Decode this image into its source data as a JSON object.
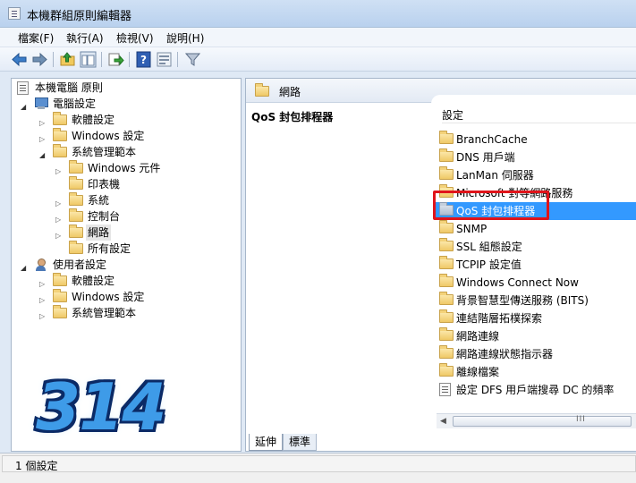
{
  "window": {
    "title": "本機群組原則編輯器"
  },
  "menu": [
    "檔案(F)",
    "執行(A)",
    "檢視(V)",
    "說明(H)"
  ],
  "toolbar": {
    "buttons": [
      "back-icon",
      "forward-icon",
      "up-folder-icon",
      "show-hide-tree-icon",
      "export-list-icon",
      "help-icon",
      "properties-icon",
      "filter-icon"
    ]
  },
  "tree": {
    "root": "本機電腦 原則",
    "computer": "電腦設定",
    "software": "軟體設定",
    "windows": "Windows 設定",
    "admin": "系統管理範本",
    "components": "Windows 元件",
    "printers": "印表機",
    "system": "系統",
    "control": "控制台",
    "network": "網路",
    "all": "所有設定",
    "user": "使用者設定",
    "u_software": "軟體設定",
    "u_windows": "Windows 設定",
    "u_admin": "系統管理範本"
  },
  "right": {
    "header": "網路",
    "extended_title": "QoS 封包排程器",
    "column": "設定",
    "items": [
      "BranchCache",
      "DNS 用戶端",
      "LanMan 伺服器",
      "Microsoft 對等網路服務",
      "QoS 封包排程器",
      "SNMP",
      "SSL 組態設定",
      "TCPIP 設定值",
      "Windows Connect Now",
      "背景智慧型傳送服務 (BITS)",
      "連結階層拓樸探索",
      "網路連線",
      "網路連線狀態指示器",
      "離線檔案",
      "設定 DFS 用戶端搜尋 DC 的頻率"
    ],
    "selected_index": 4,
    "scroll_grip": "III"
  },
  "tabs": [
    "延伸",
    "標準"
  ],
  "status": "1 個設定",
  "watermark": "314"
}
